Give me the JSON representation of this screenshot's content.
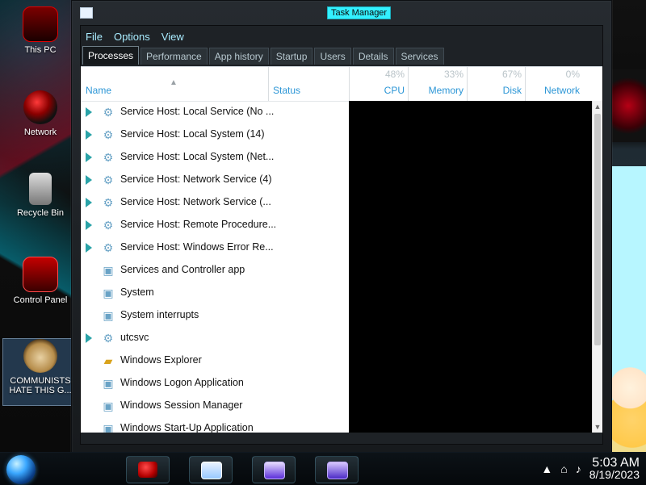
{
  "desktop": {
    "icons": [
      {
        "label": "This PC",
        "icon": "computer-icon"
      },
      {
        "label": "Network",
        "icon": "network-icon"
      },
      {
        "label": "Recycle Bin",
        "icon": "recycle-bin-icon"
      },
      {
        "label": "Control Panel",
        "icon": "control-panel-icon"
      },
      {
        "label": "COMMUNISTS HATE THIS G...",
        "icon": "money-bag-icon"
      }
    ]
  },
  "window": {
    "title": "Task Manager",
    "menu": [
      "File",
      "Options",
      "View"
    ],
    "tabs": [
      {
        "label": "Processes",
        "active": true
      },
      {
        "label": "Performance"
      },
      {
        "label": "App history"
      },
      {
        "label": "Startup"
      },
      {
        "label": "Users"
      },
      {
        "label": "Details"
      },
      {
        "label": "Services"
      }
    ],
    "columns": {
      "name": "Name",
      "status": "Status",
      "cpu": {
        "label": "CPU",
        "pct": "48%"
      },
      "memory": {
        "label": "Memory",
        "pct": "33%"
      },
      "disk": {
        "label": "Disk",
        "pct": "67%"
      },
      "network": {
        "label": "Network",
        "pct": "0%"
      }
    },
    "processes": [
      {
        "name": "Service Host: Local Service (No ...",
        "icon": "gear-icon",
        "expandable": true
      },
      {
        "name": "Service Host: Local System (14)",
        "icon": "gear-icon",
        "expandable": true
      },
      {
        "name": "Service Host: Local System (Net...",
        "icon": "gear-icon",
        "expandable": true
      },
      {
        "name": "Service Host: Network Service (4)",
        "icon": "gear-icon",
        "expandable": true
      },
      {
        "name": "Service Host: Network Service (...",
        "icon": "gear-icon",
        "expandable": true
      },
      {
        "name": "Service Host: Remote Procedure...",
        "icon": "gear-icon",
        "expandable": true
      },
      {
        "name": "Service Host: Windows Error Re...",
        "icon": "gear-icon",
        "expandable": true
      },
      {
        "name": "Services and Controller app",
        "icon": "window-icon",
        "expandable": false
      },
      {
        "name": "System",
        "icon": "window-icon",
        "expandable": false
      },
      {
        "name": "System interrupts",
        "icon": "window-icon",
        "expandable": false
      },
      {
        "name": "utcsvc",
        "icon": "gear-icon",
        "expandable": true
      },
      {
        "name": "Windows Explorer",
        "icon": "folder-icon",
        "expandable": false
      },
      {
        "name": "Windows Logon Application",
        "icon": "window-icon",
        "expandable": false
      },
      {
        "name": "Windows Session Manager",
        "icon": "window-icon",
        "expandable": false
      },
      {
        "name": "Windows Start-Up Application",
        "icon": "window-icon",
        "expandable": false
      }
    ]
  },
  "tray": {
    "time": "5:03 AM",
    "date": "8/19/2023",
    "icons": [
      "network-tray-icon",
      "volume-icon",
      "notification-arrow-icon"
    ]
  }
}
